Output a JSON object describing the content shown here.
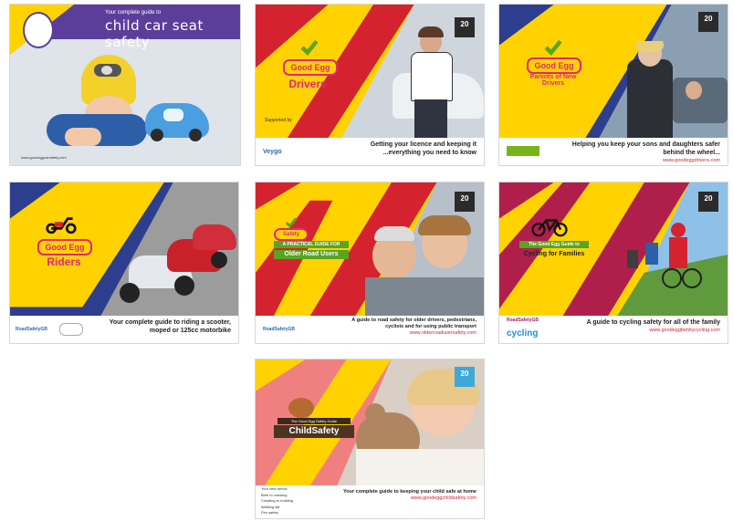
{
  "cards": {
    "car_seat": {
      "subtitle": "Your complete guide to",
      "title": "child car seat safety",
      "url": "www.goodeggcarsafety.com"
    },
    "drivers": {
      "brand": "Good Egg",
      "title": "Drivers",
      "badge": "20",
      "tagline": "Getting your licence and keeping it ...everything you need to know",
      "sponsor": "Veygo",
      "supported": "Supported by"
    },
    "parents": {
      "brand": "Good Egg",
      "title": "Parents of New Drivers",
      "badge": "20",
      "tagline": "Helping you keep your sons and daughters safer behind the wheel...",
      "url": "www.goodeggdrivers.com"
    },
    "riders": {
      "brand": "Good Egg",
      "title": "Riders",
      "tagline": "Your complete guide to riding a scooter, moped or 125cc motorbike",
      "logo": "RoadSafetyGB"
    },
    "older": {
      "brand": "Safety",
      "title": "Older Road Users",
      "banner": "A PRACTICAL GUIDE FOR",
      "badge": "20",
      "tagline": "A guide to road safety for older drivers, pedestrians, cyclists and for using public transport",
      "url": "www.olderroadusersafety.com",
      "logo": "RoadSafetyGB"
    },
    "cycling": {
      "banner": "The Good Egg Guide to",
      "title": "Cycling for Families",
      "badge": "20",
      "tagline": "A guide to cycling safety for all of the family",
      "url": "www.goodeggfamilycycling.com",
      "logo": "RoadSafetyGB",
      "partner": "cycling"
    },
    "child": {
      "banner": "The Good Egg Safety Guide",
      "title": "ChildSafety",
      "badge": "20",
      "tagline": "Your complete guide to keeping your child safe at home",
      "url": "www.goodeggchildsafety.com",
      "list": [
        "Your new arrival",
        "Birth to crawling",
        "Crawling to toddling",
        "Walking tall",
        "Fire safety"
      ]
    }
  },
  "colors": {
    "yellow": "#ffd200",
    "red": "#d4232e",
    "blue": "#2d3e8f",
    "purple": "#5b3e9a",
    "pink": "#e4267d",
    "salmon": "#f08080",
    "green": "#7ab41d"
  }
}
